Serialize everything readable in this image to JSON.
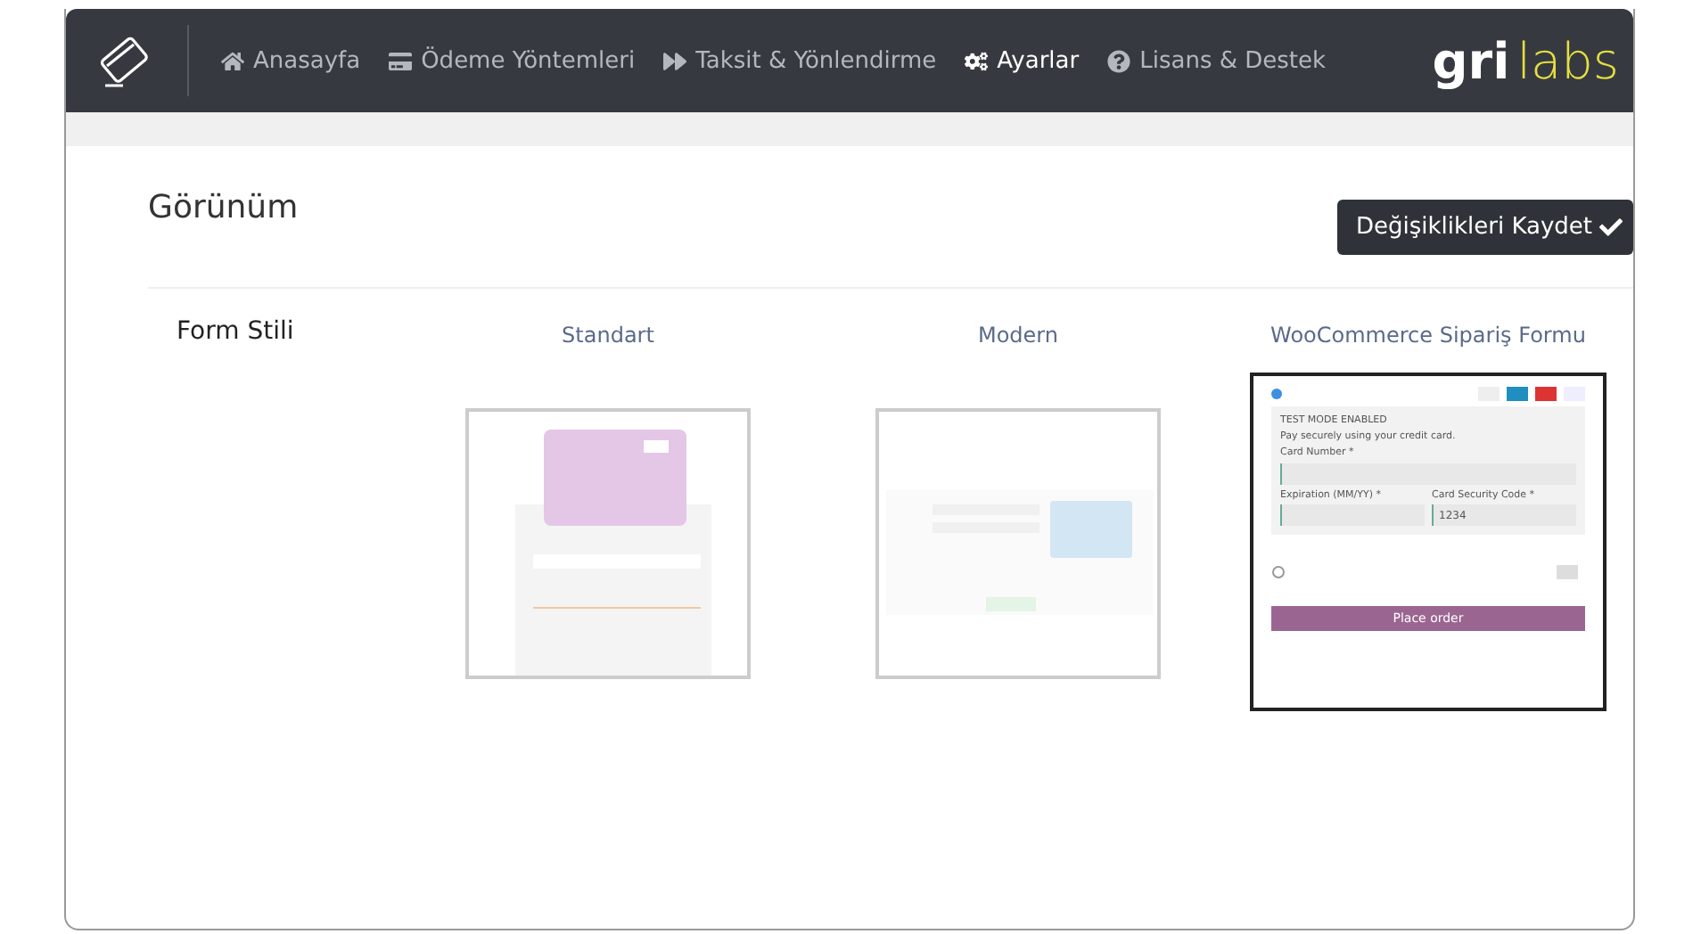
{
  "nav": {
    "items": [
      {
        "label": "Anasayfa",
        "kind": "home",
        "selected": false
      },
      {
        "label": "Ödeme Yöntemleri",
        "kind": "card",
        "selected": false
      },
      {
        "label": "Taksit & Yönlendirme",
        "kind": "forward",
        "selected": false
      },
      {
        "label": "Ayarlar",
        "kind": "cogs",
        "selected": true
      },
      {
        "label": "Lisans & Destek",
        "kind": "help",
        "selected": false
      }
    ],
    "logo": {
      "part_1": "gri",
      "part_2": "labs"
    }
  },
  "section": {
    "title": "Görünüm",
    "save_button": "Değişiklikleri Kaydet"
  },
  "form_style": {
    "label": "Form Stili",
    "options": [
      {
        "label": "Standart",
        "kind": "standard",
        "selected": false
      },
      {
        "label": "Modern",
        "kind": "modern",
        "selected": false
      },
      {
        "label": "WooCommerce Sipariş Formu",
        "kind": "woocommerce",
        "selected": true,
        "preview": {
          "mode": "TEST MODE ENABLED",
          "note": "Pay securely using your credit card.",
          "card_number": "Card Number *",
          "expiration": "Expiration (MM/YY) *",
          "security_code": "Card Security Code *",
          "security_value": "1234",
          "button": "Place order"
        }
      }
    ]
  }
}
